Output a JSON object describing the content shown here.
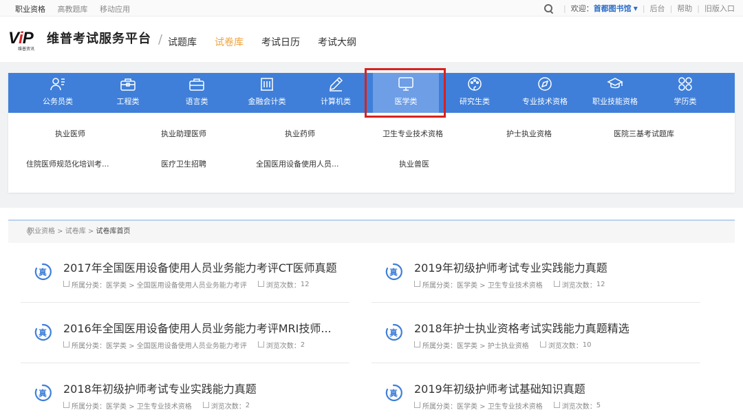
{
  "topbar": {
    "left_links": [
      "职业资格",
      "高教题库",
      "移动应用"
    ],
    "welcome": "欢迎：",
    "library": "首都图书馆",
    "links": [
      "后台",
      "帮助",
      "旧版入口"
    ]
  },
  "header": {
    "logo_text": "VIP",
    "logo_sub": "维普资讯",
    "site_name": "维普考试服务平台",
    "nav": [
      "试题库",
      "试卷库",
      "考试日历",
      "考试大纲"
    ],
    "active_nav": "试卷库"
  },
  "categories": [
    {
      "label": "公务员类",
      "icon": "person-list-icon"
    },
    {
      "label": "工程类",
      "icon": "toolbox-icon"
    },
    {
      "label": "语言类",
      "icon": "briefcase-icon"
    },
    {
      "label": "金融会计类",
      "icon": "bank-icon"
    },
    {
      "label": "计算机类",
      "icon": "pencil-icon"
    },
    {
      "label": "医学类",
      "icon": "monitor-icon"
    },
    {
      "label": "研究生类",
      "icon": "palette-icon"
    },
    {
      "label": "专业技术资格",
      "icon": "compass-icon"
    },
    {
      "label": "职业技能资格",
      "icon": "graduation-cap-icon"
    },
    {
      "label": "学历类",
      "icon": "grid-circles-icon"
    }
  ],
  "active_category": "医学类",
  "subcategories": [
    "执业医师",
    "执业助理医师",
    "执业药师",
    "卫生专业技术资格",
    "护士执业资格",
    "医院三基考试题库",
    "住院医师规范化培训考...",
    "医疗卫生招聘",
    "全国医用设备使用人员...",
    "执业兽医"
  ],
  "breadcrumb": {
    "items": [
      "职业资格",
      "试卷库"
    ],
    "current": "试卷库首页",
    "sep": " > "
  },
  "papers": [
    {
      "badge": "真",
      "title": "2017年全国医用设备使用人员业务能力考评CT医师真题",
      "category_label": "所属分类：",
      "category": "医学类 > 全国医用设备使用人员业务能力考评",
      "views_label": "浏览次数：",
      "views": "12"
    },
    {
      "badge": "真",
      "title": "2019年初级护师考试专业实践能力真题",
      "category_label": "所属分类：",
      "category": "医学类 > 卫生专业技术资格",
      "views_label": "浏览次数：",
      "views": "12"
    },
    {
      "badge": "真",
      "title": "2016年全国医用设备使用人员业务能力考评MRI技师...",
      "category_label": "所属分类：",
      "category": "医学类 > 全国医用设备使用人员业务能力考评",
      "views_label": "浏览次数：",
      "views": "2"
    },
    {
      "badge": "真",
      "title": "2018年护士执业资格考试实践能力真题精选",
      "category_label": "所属分类：",
      "category": "医学类 > 护士执业资格",
      "views_label": "浏览次数：",
      "views": "10"
    },
    {
      "badge": "真",
      "title": "2018年初级护师考试专业实践能力真题",
      "category_label": "所属分类：",
      "category": "医学类 > 卫生专业技术资格",
      "views_label": "浏览次数：",
      "views": "2"
    },
    {
      "badge": "真",
      "title": "2019年初级护师考试基础知识真题",
      "category_label": "所属分类：",
      "category": "医学类 > 卫生专业技术资格",
      "views_label": "浏览次数：",
      "views": "5"
    }
  ],
  "colors": {
    "category_bar": "#3f7fd9",
    "active_category": "#6e9ee6",
    "active_nav": "#f0a23a",
    "highlight": "#d6221f",
    "badge": "#3f7fd9"
  }
}
